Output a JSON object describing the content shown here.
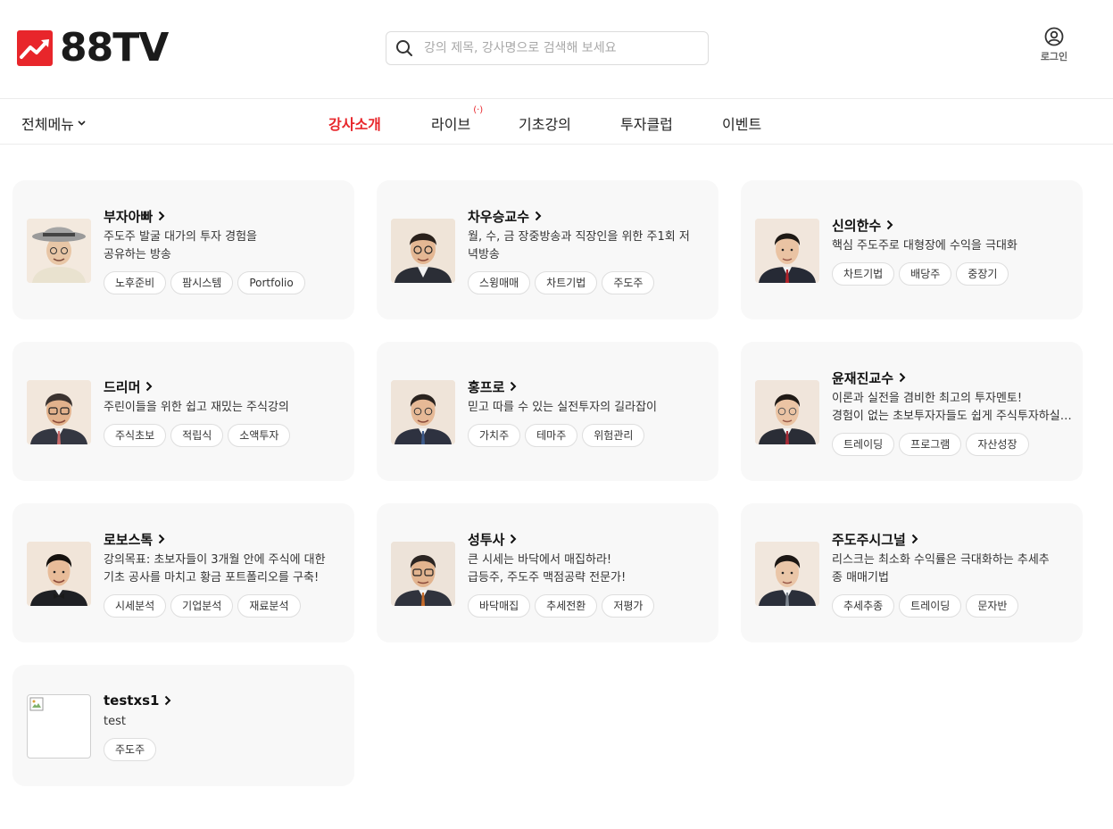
{
  "brand": {
    "name": "88TV",
    "accent": "#e8262b"
  },
  "search": {
    "placeholder": "강의 제목, 강사명으로 검색해 보세요"
  },
  "account": {
    "login_label": "로그인"
  },
  "nav": {
    "all_menu": "전체메뉴",
    "items": [
      {
        "label": "강사소개",
        "active": true
      },
      {
        "label": "라이브",
        "badge": "(·)"
      },
      {
        "label": "기초강의"
      },
      {
        "label": "투자클럽"
      },
      {
        "label": "이벤트"
      }
    ]
  },
  "instructors": [
    {
      "name": "부자아빠",
      "desc": [
        "주도주 발굴 대가의 투자 경험을",
        "공유하는 방송"
      ],
      "tags": [
        "노후준비",
        "팜시스템",
        "Portfolio"
      ],
      "avatar": "elder-hat"
    },
    {
      "name": "차우승교수",
      "desc": [
        "월, 수, 금 장중방송과 직장인을 위한 주1회 저",
        "녁방송"
      ],
      "tags": [
        "스윙매매",
        "차트기법",
        "주도주"
      ],
      "avatar": "glasses-man"
    },
    {
      "name": "신의한수",
      "desc": [
        "핵심 주도주로 대형장에 수익을 극대화"
      ],
      "tags": [
        "차트기법",
        "배당주",
        "중장기"
      ],
      "avatar": "young-man"
    },
    {
      "name": "드리머",
      "desc": [
        "주린이들을 위한 쉽고 재밌는 주식강의"
      ],
      "tags": [
        "주식초보",
        "적립식",
        "소액투자"
      ],
      "avatar": "glasses-man"
    },
    {
      "name": "홍프로",
      "desc": [
        "믿고 따를 수 있는 실전투자의 길라잡이"
      ],
      "tags": [
        "가치주",
        "테마주",
        "위험관리"
      ],
      "avatar": "glasses-man"
    },
    {
      "name": "윤재진교수",
      "desc": [
        "이론과 실전을 겸비한 최고의 투자멘토!",
        "경험이 없는 초보투자자들도 쉽게 주식투자하실 수 있도록"
      ],
      "tags": [
        "트레이딩",
        "프로그램",
        "자산성장"
      ],
      "avatar": "glasses-man"
    },
    {
      "name": "로보스톡",
      "desc": [
        "강의목표: 초보자들이 3개월 안에 주식에 대한",
        "기초 공사를 마치고 황금 포트폴리오를 구축!"
      ],
      "tags": [
        "시세분석",
        "기업분석",
        "재료분석"
      ],
      "avatar": "young-man"
    },
    {
      "name": "성투사",
      "desc": [
        "큰 시세는 바닥에서 매집하라!",
        "급등주, 주도주 맥점공략 전문가!"
      ],
      "tags": [
        "바닥매집",
        "추세전환",
        "저평가"
      ],
      "avatar": "glasses-man"
    },
    {
      "name": "주도주시그널",
      "desc": [
        "리스크는 최소화 수익률은 극대화하는 추세추",
        "종 매매기법"
      ],
      "tags": [
        "추세추종",
        "트레이딩",
        "문자반"
      ],
      "avatar": "young-man"
    },
    {
      "name": "testxs1",
      "desc": [
        "test"
      ],
      "tags": [
        "주도주"
      ],
      "avatar": "broken"
    }
  ]
}
